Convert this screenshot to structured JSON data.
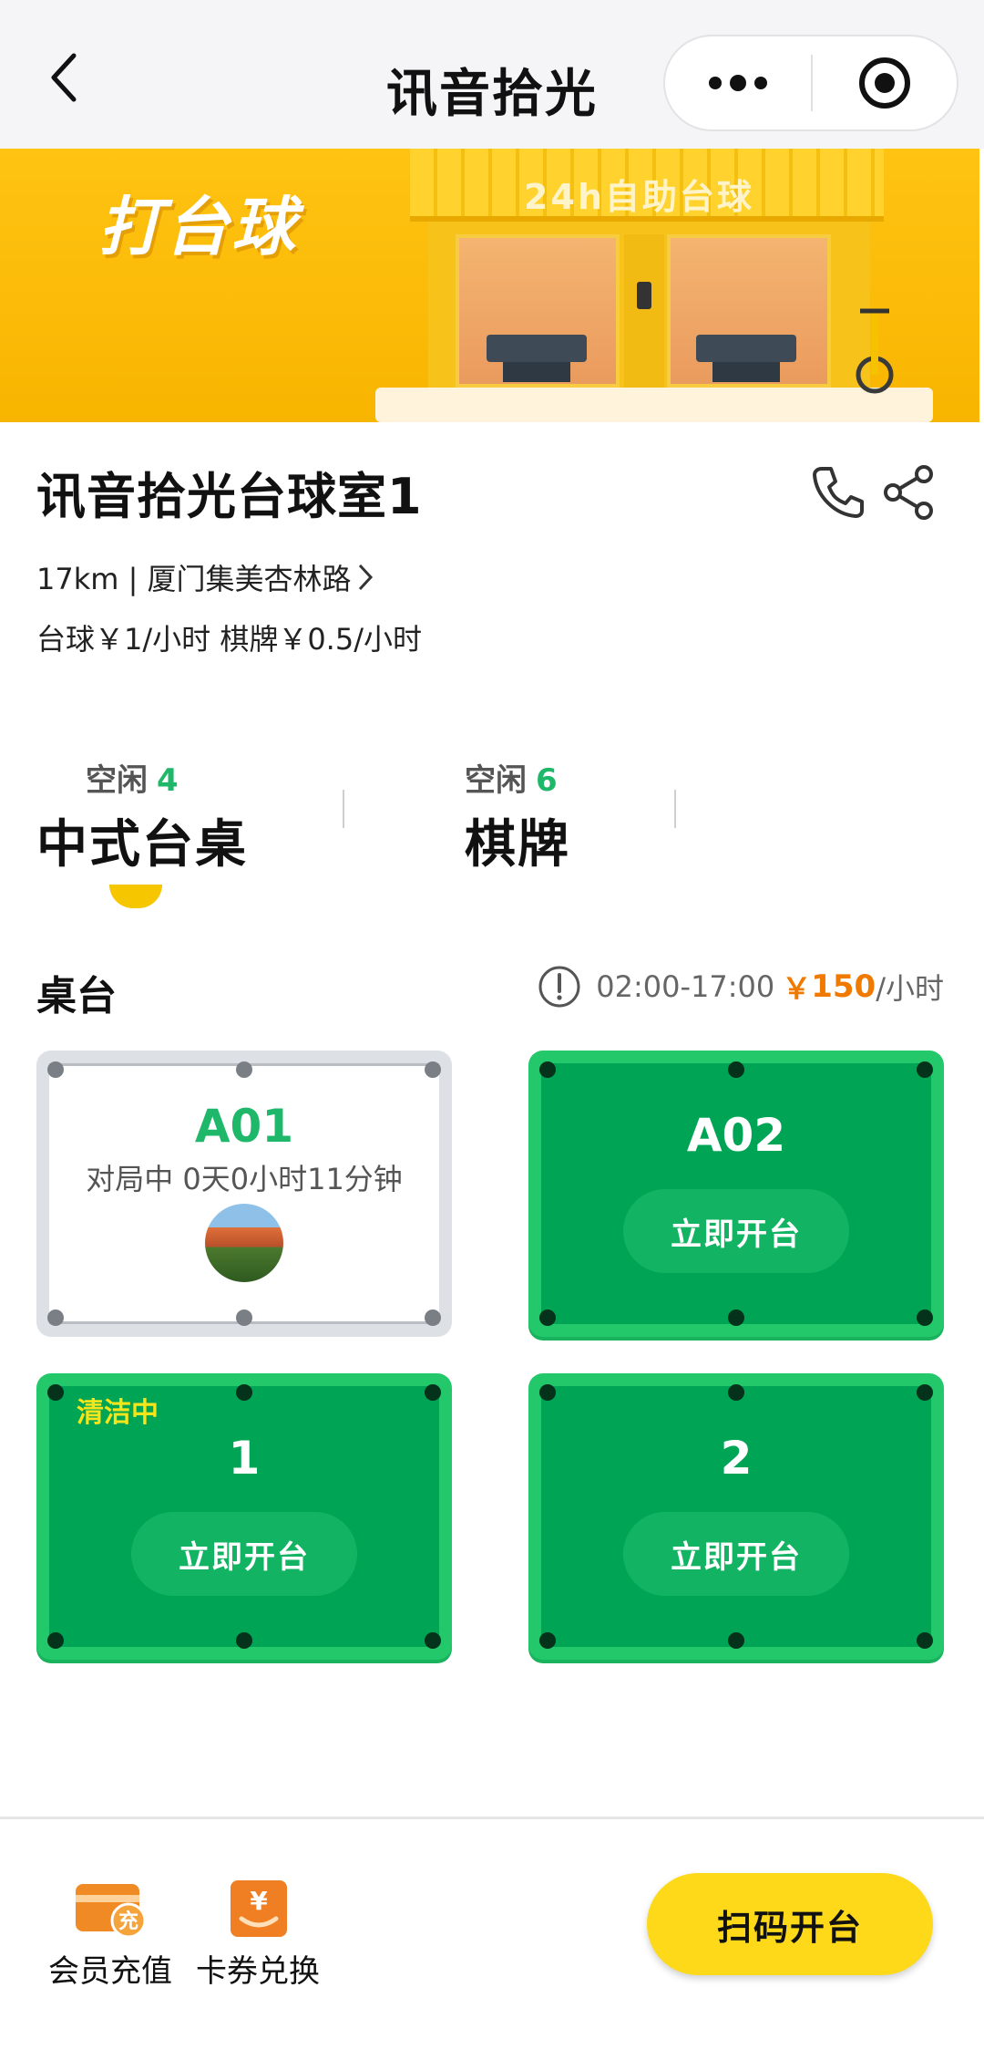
{
  "navbar": {
    "title": "讯音拾光",
    "back_icon": "chevron-left-icon",
    "more_icon": "more-dots-icon",
    "close_icon": "target-close-icon"
  },
  "banner": {
    "headline": "打台球",
    "shop_sign": "24h自助台球"
  },
  "store": {
    "name": "讯音拾光台球室1",
    "address": "17km | 厦门集美杏林路",
    "prices": "台球￥1/小时 棋牌￥0.5/小时",
    "phone_icon": "phone-icon",
    "share_icon": "share-icon"
  },
  "tabs": [
    {
      "idle_label": "空闲",
      "idle_count": "4",
      "name": "中式台桌",
      "active": true
    },
    {
      "idle_label": "空闲",
      "idle_count": "6",
      "name": "棋牌",
      "active": false
    }
  ],
  "section": {
    "title": "桌台",
    "hours": "02:00-17:00",
    "price_symbol": "￥",
    "price_value": "150",
    "price_unit": "/小时"
  },
  "tables": [
    {
      "id": "A01",
      "state": "busy",
      "status_text": "对局中 0天0小时11分钟"
    },
    {
      "id": "A02",
      "state": "free",
      "button": "立即开台"
    },
    {
      "id": "1",
      "state": "free",
      "tag": "清洁中",
      "button": "立即开台"
    },
    {
      "id": "2",
      "state": "free",
      "button": "立即开台"
    }
  ],
  "bottom_bar": {
    "recharge_label": "会员充值",
    "recharge_icon_text": "充",
    "coupon_label": "卡券兑换",
    "coupon_icon_text": "¥",
    "scan_button": "扫码开台"
  },
  "colors": {
    "brand_yellow": "#fdd91a",
    "table_green": "#00a455",
    "idle_green": "#1fb86a",
    "price_orange": "#f07a00"
  }
}
